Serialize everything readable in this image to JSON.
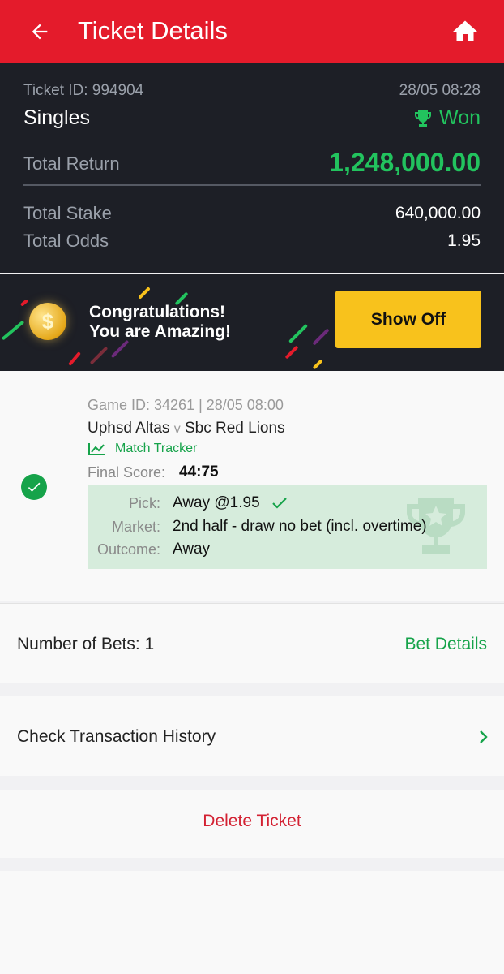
{
  "header": {
    "title": "Ticket Details",
    "back_icon": "arrow-left-icon",
    "home_icon": "home-icon",
    "bg_color": "#e41b2b"
  },
  "summary": {
    "ticket_id": "Ticket ID: 994904",
    "datetime": "28/05 08:28",
    "bet_type": "Singles",
    "status": "Won",
    "status_icon": "trophy-icon",
    "total_return_label": "Total Return",
    "total_return_value": "1,248,000.00",
    "total_stake_label": "Total Stake",
    "total_stake_value": "640,000.00",
    "total_odds_label": "Total Odds",
    "total_odds_value": "1.95",
    "won_color": "#22c35e"
  },
  "banner": {
    "line1": "Congratulations!",
    "line2": "You are Amazing!",
    "coin_symbol": "$",
    "show_off_label": "Show Off"
  },
  "game": {
    "game_id": "Game ID: 34261 | 28/05 08:00",
    "home_team": "Uphsd Altas",
    "vs": "v",
    "away_team": "Sbc Red Lions",
    "tracker_label": "Match Tracker",
    "final_score_label": "Final Score:",
    "final_score_value": "44:75",
    "pick_label": "Pick:",
    "pick_value": "Away @1.95",
    "market_label": "Market:",
    "market_value": "2nd half - draw no bet (incl. overtime)",
    "outcome_label": "Outcome:",
    "outcome_value": "Away"
  },
  "bets": {
    "count_label": "Number of Bets: 1",
    "details_link": "Bet Details"
  },
  "transactions": {
    "label": "Check Transaction History",
    "chevron_icon": "chevron-right-icon"
  },
  "delete": {
    "label": "Delete Ticket"
  }
}
